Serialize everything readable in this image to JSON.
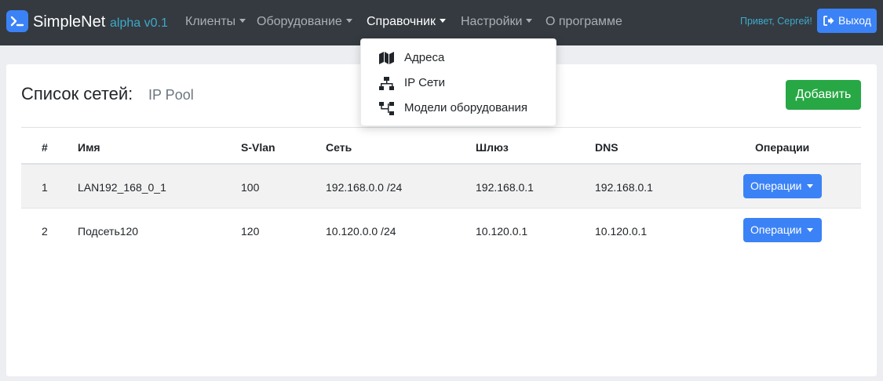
{
  "navbar": {
    "brand": {
      "name": "SimpleNet",
      "version": "alpha v0.1"
    },
    "items": [
      {
        "label": "Клиенты",
        "dropdown": true
      },
      {
        "label": "Оборудование",
        "dropdown": true
      },
      {
        "label": "Справочник",
        "dropdown": true,
        "active": true
      },
      {
        "label": "Настройки",
        "dropdown": true
      },
      {
        "label": "О программе",
        "dropdown": false
      }
    ],
    "greeting": "Привет, Сергей!",
    "logout_label": "Выход"
  },
  "dropdown_menu": {
    "items": [
      {
        "label": "Адреса",
        "icon": "map-icon"
      },
      {
        "label": "IP Сети",
        "icon": "network-icon"
      },
      {
        "label": "Модели оборудования",
        "icon": "sitemap-icon"
      }
    ]
  },
  "page": {
    "title": "Список сетей:",
    "subtitle": "IP Pool",
    "add_button": "Добавить"
  },
  "table": {
    "columns": [
      "#",
      "Имя",
      "S-Vlan",
      "Сеть",
      "Шлюз",
      "DNS",
      "Операции"
    ],
    "rows": [
      {
        "num": "1",
        "name": "LAN192_168_0_1",
        "svlan": "100",
        "network": "192.168.0.0 /24",
        "gateway": "192.168.0.1",
        "dns": "192.168.0.1",
        "ops": "Операции"
      },
      {
        "num": "2",
        "name": "Подсеть120",
        "svlan": "120",
        "network": "10.120.0.0 /24",
        "gateway": "10.120.0.1",
        "dns": "10.120.0.1",
        "ops": "Операции"
      }
    ]
  },
  "colors": {
    "navbar": "#343a40",
    "primary": "#3b82f6",
    "success": "#28a745",
    "info": "#3fa9c9",
    "striped_row": "#f2f2f2"
  }
}
